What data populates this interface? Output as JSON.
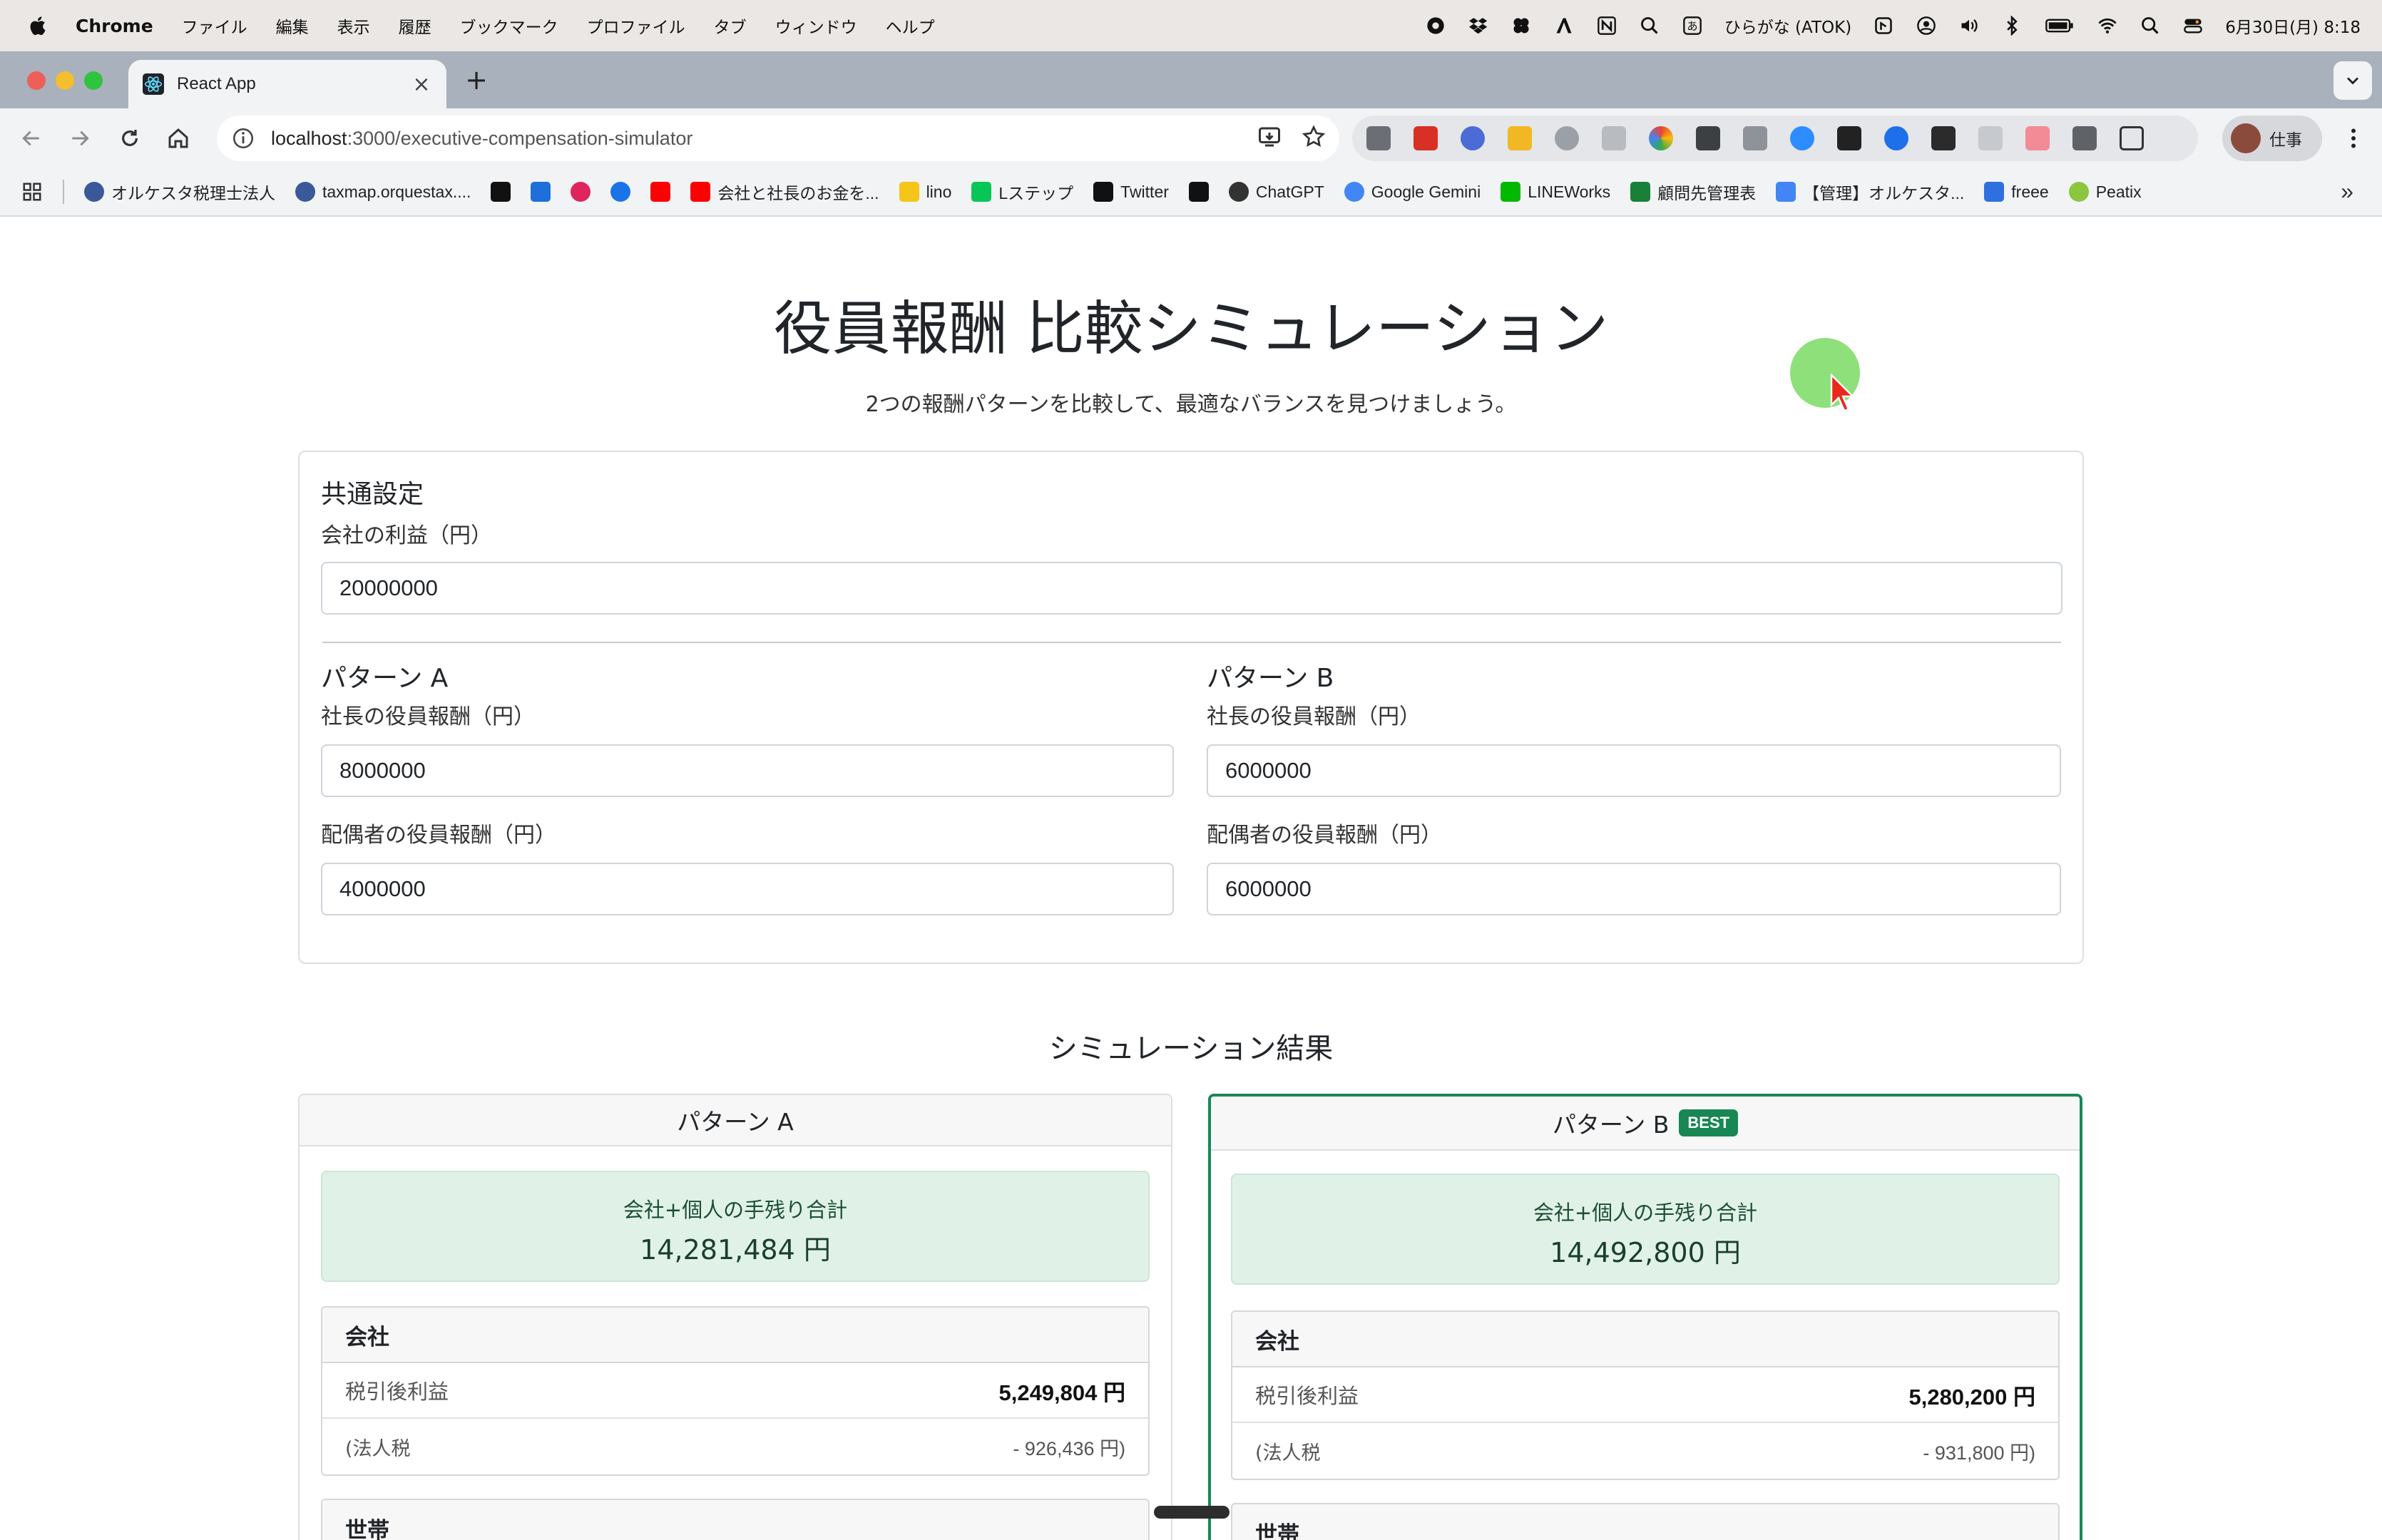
{
  "menubar": {
    "app_name": "Chrome",
    "items": [
      "ファイル",
      "編集",
      "表示",
      "履歴",
      "ブックマーク",
      "プロファイル",
      "タブ",
      "ウィンドウ",
      "ヘルプ"
    ],
    "ime": "ひらがな (ATOK)",
    "datetime": "6月30日(月) 8:18"
  },
  "tab": {
    "title": "React App"
  },
  "toolbar": {
    "url_host": "localhost",
    "url_path": ":3000/executive-compensation-simulator",
    "profile_label": "仕事"
  },
  "bookmarks": [
    "オルケスタ税理士法人",
    "taxmap.orquestax....",
    "",
    "",
    "",
    "",
    "",
    "会社と社長のお金を...",
    "lino",
    "Lステップ",
    "Twitter",
    "",
    "ChatGPT",
    "Google Gemini",
    "LINEWorks",
    "顧問先管理表",
    "【管理】オルケスタ...",
    "freee",
    "Peatix"
  ],
  "page": {
    "title": "役員報酬 比較シミュレーション",
    "lead": "2つの報酬パターンを比較して、最適なバランスを見つけましょう。",
    "common": {
      "heading": "共通設定",
      "profit_label": "会社の利益（円）",
      "profit_value": "20000000"
    },
    "pattern_a": {
      "heading": "パターン A",
      "ceo_label": "社長の役員報酬（円）",
      "ceo_value": "8000000",
      "spouse_label": "配偶者の役員報酬（円）",
      "spouse_value": "4000000"
    },
    "pattern_b": {
      "heading": "パターン B",
      "ceo_label": "社長の役員報酬（円）",
      "ceo_value": "6000000",
      "spouse_label": "配偶者の役員報酬（円）",
      "spouse_value": "6000000"
    },
    "results_title": "シミュレーション結果",
    "result_a": {
      "heading": "パターン A",
      "total_label": "会社+個人の手残り合計",
      "total_value": "14,281,484 円",
      "company_heading": "会社",
      "after_tax_label": "税引後利益",
      "after_tax_value": "5,249,804 円",
      "corp_tax_label": "(法人税",
      "corp_tax_value": "- 926,436 円)",
      "household_heading": "世帯"
    },
    "result_b": {
      "heading": "パターン B",
      "badge": "BEST",
      "total_label": "会社+個人の手残り合計",
      "total_value": "14,492,800 円",
      "company_heading": "会社",
      "after_tax_label": "税引後利益",
      "after_tax_value": "5,280,200 円",
      "corp_tax_label": "(法人税",
      "corp_tax_value": "- 931,800 円)",
      "household_heading": "世帯"
    }
  },
  "colors": {
    "best_accent": "#198754",
    "total_bg": "#e0f2e7",
    "tabstrip": "#a9b1bc"
  }
}
